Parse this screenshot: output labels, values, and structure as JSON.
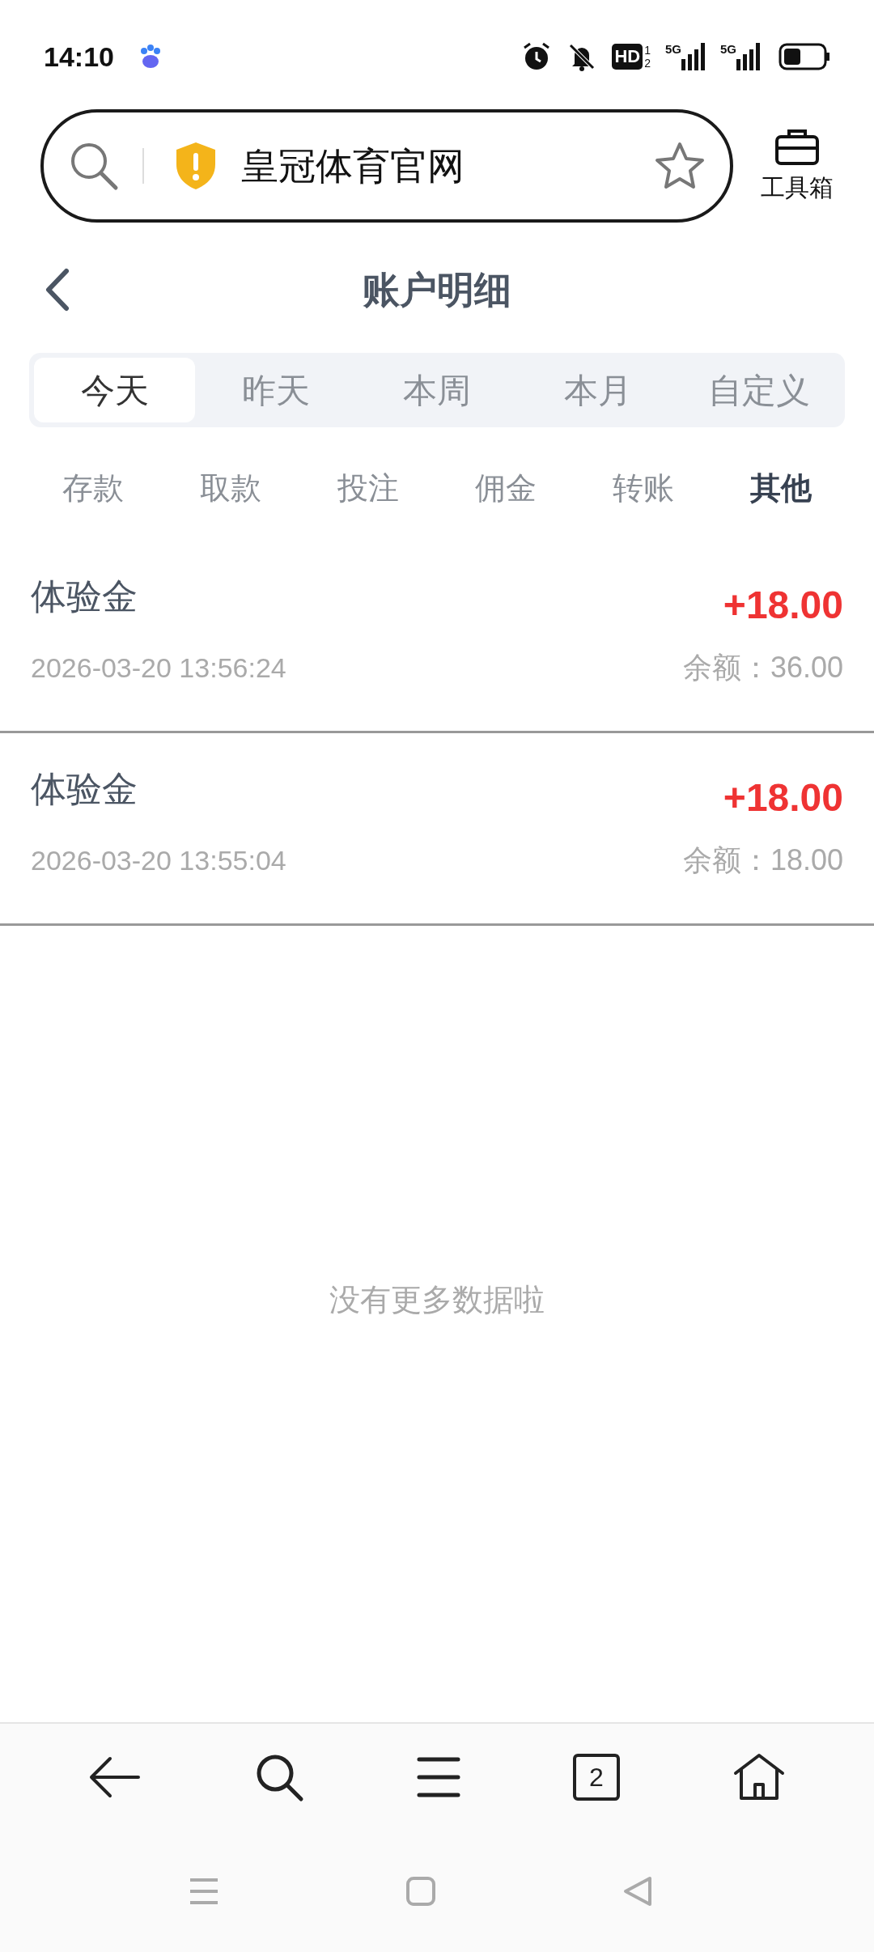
{
  "status_bar": {
    "time": "14:10",
    "hd_label": "HD",
    "sim_slots": [
      "1",
      "2"
    ],
    "network_labels": [
      "5G",
      "5G"
    ]
  },
  "address_bar": {
    "title": "皇冠体育官网",
    "toolbox_label": "工具箱"
  },
  "header": {
    "title": "账户明细"
  },
  "period_tabs": [
    {
      "label": "今天",
      "selected": true
    },
    {
      "label": "昨天",
      "selected": false
    },
    {
      "label": "本周",
      "selected": false
    },
    {
      "label": "本月",
      "selected": false
    },
    {
      "label": "自定义",
      "selected": false
    }
  ],
  "categories": [
    {
      "label": "存款",
      "selected": false
    },
    {
      "label": "取款",
      "selected": false
    },
    {
      "label": "投注",
      "selected": false
    },
    {
      "label": "佣金",
      "selected": false
    },
    {
      "label": "转账",
      "selected": false
    },
    {
      "label": "其他",
      "selected": true
    }
  ],
  "records": [
    {
      "title": "体验金",
      "time": "2026-03-20 13:56:24",
      "amount": "+18.00",
      "balance": "余额：36.00"
    },
    {
      "title": "体验金",
      "time": "2026-03-20 13:55:04",
      "amount": "+18.00",
      "balance": "余额：18.00"
    }
  ],
  "empty_message": "没有更多数据啦",
  "browser_toolbar": {
    "tab_count": "2"
  }
}
